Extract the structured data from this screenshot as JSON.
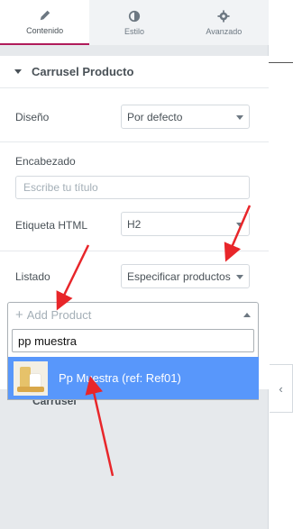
{
  "tabs": [
    {
      "label": "Contenido",
      "icon": "pencil-icon"
    },
    {
      "label": "Estilo",
      "icon": "half-circle-icon"
    },
    {
      "label": "Avanzado",
      "icon": "gear-icon"
    }
  ],
  "section": {
    "title": "Carrusel Producto"
  },
  "fields": {
    "diseno": {
      "label": "Diseño",
      "value": "Por defecto"
    },
    "encabezado": {
      "label": "Encabezado",
      "placeholder": "Escribe tu título"
    },
    "etiqueta": {
      "label": "Etiqueta HTML",
      "value": "H2"
    },
    "listado": {
      "label": "Listado",
      "value": "Especificar productos"
    }
  },
  "product_select": {
    "placeholder": "Add Product",
    "search_value": "pp muestra",
    "result": "Pp Muestra (ref: Ref01)"
  },
  "behind_label": "Carrusel",
  "colors": {
    "accent": "#b01b5a",
    "highlight": "#5897fb",
    "arrow": "#e8262a"
  }
}
